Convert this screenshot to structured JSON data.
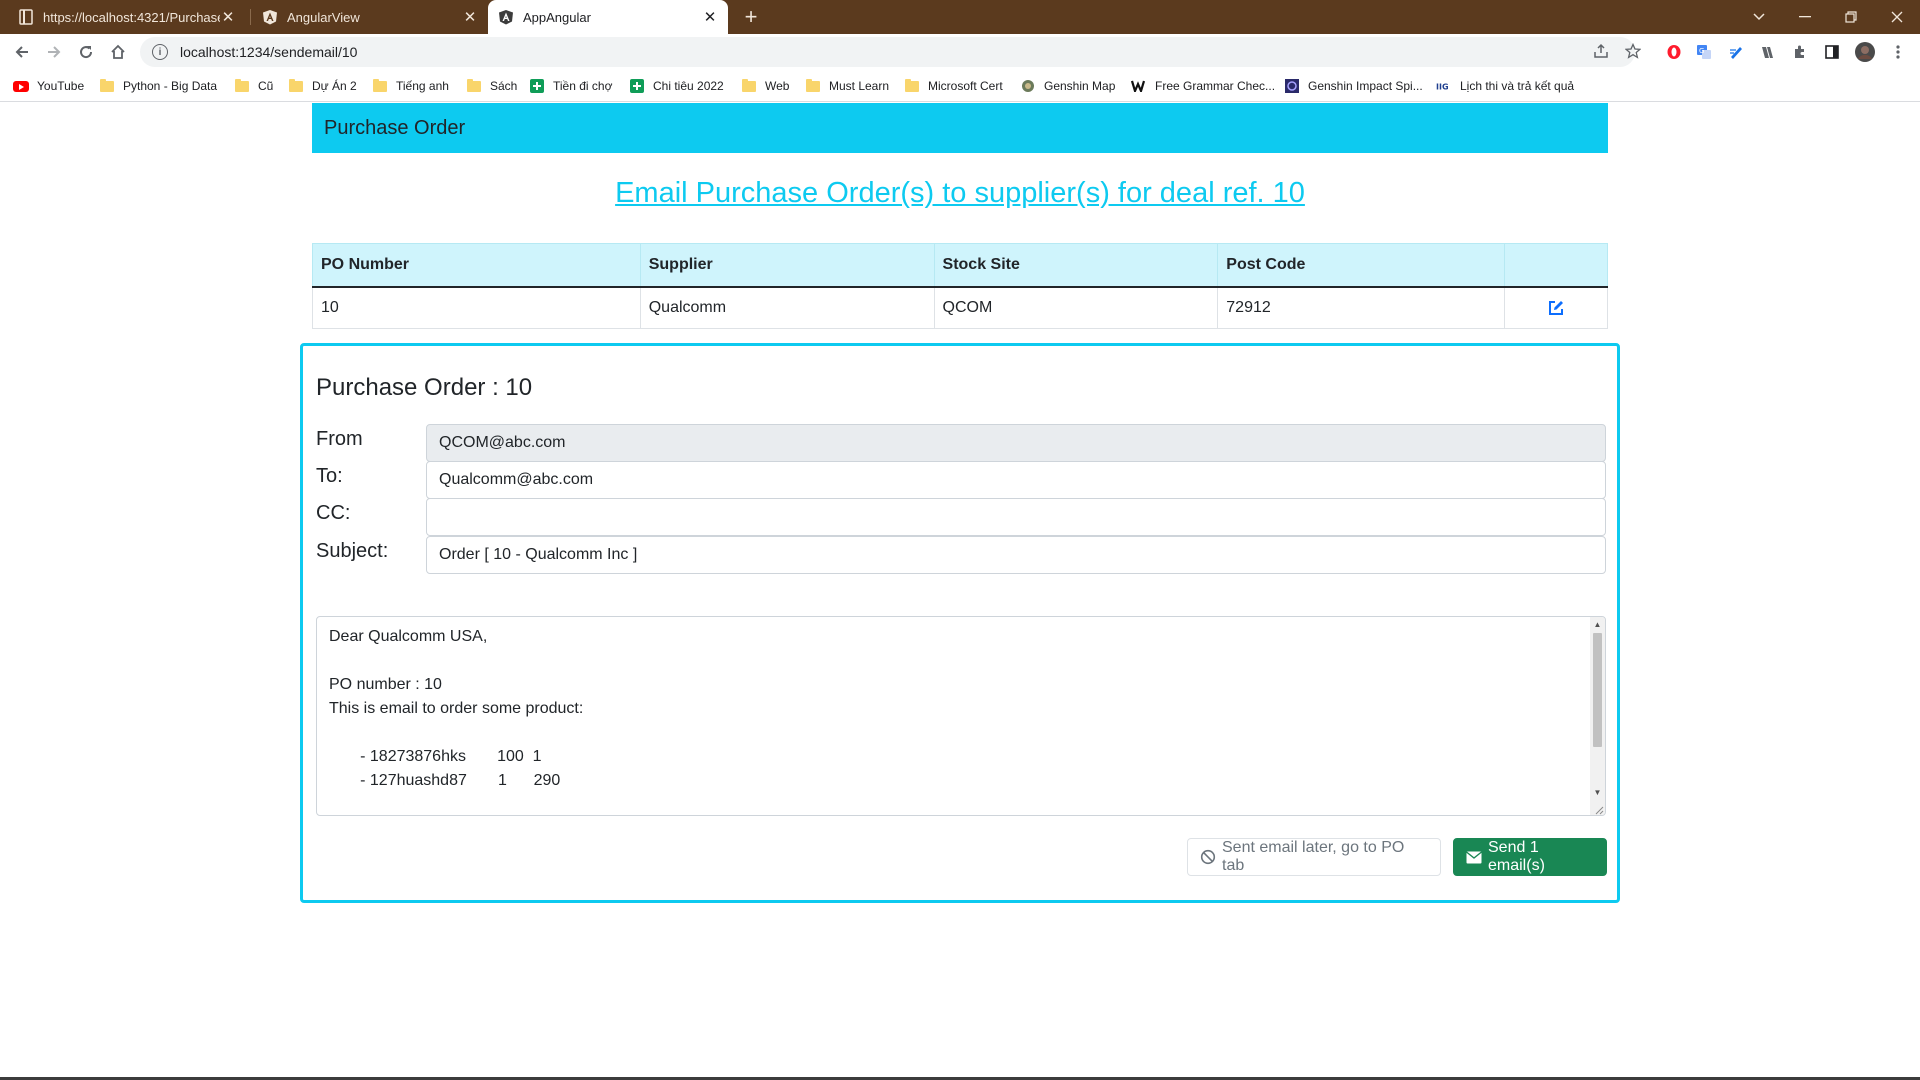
{
  "browser": {
    "tabs": [
      {
        "title": "https://localhost:4321/PurchaseC",
        "icon": "page-icon",
        "active": false
      },
      {
        "title": "AngularView",
        "icon": "angular-icon",
        "active": false
      },
      {
        "title": "AppAngular",
        "icon": "angular-icon",
        "active": true
      }
    ],
    "url": "localhost:1234/sendemail/10",
    "bookmarks": [
      {
        "label": "YouTube",
        "icon": "youtube-icon"
      },
      {
        "label": "Python - Big Data",
        "icon": "folder-icon"
      },
      {
        "label": "Cũ",
        "icon": "folder-icon"
      },
      {
        "label": "Dự Án 2",
        "icon": "folder-icon"
      },
      {
        "label": "Tiếng anh",
        "icon": "folder-icon"
      },
      {
        "label": "Sách",
        "icon": "folder-icon"
      },
      {
        "label": "Tiền đi chợ",
        "icon": "sheets-icon"
      },
      {
        "label": "Chi tiêu 2022",
        "icon": "sheets-icon"
      },
      {
        "label": "Web",
        "icon": "folder-icon"
      },
      {
        "label": "Must Learn",
        "icon": "folder-icon"
      },
      {
        "label": "Microsoft Cert",
        "icon": "folder-icon"
      },
      {
        "label": "Genshin Map",
        "icon": "genshin-icon"
      },
      {
        "label": "Free Grammar Chec...",
        "icon": "w-icon"
      },
      {
        "label": "Genshin Impact Spi...",
        "icon": "genshin-spiral-icon"
      },
      {
        "label": "Lịch thi và trả kết quả",
        "icon": "iig-icon"
      }
    ]
  },
  "app": {
    "brand": "Purchase Order",
    "heading": "Email Purchase Order(s) to supplier(s) for deal ref. 10",
    "table": {
      "headers": [
        "PO Number",
        "Supplier",
        "Stock Site",
        "Post Code",
        ""
      ],
      "rows": [
        {
          "po_number": "10",
          "supplier": "Qualcomm",
          "stock_site": "QCOM",
          "post_code": "72912"
        }
      ]
    },
    "email": {
      "title": "Purchase Order : 10",
      "from_label": "From",
      "from_value": "QCOM@abc.com",
      "to_label": "To:",
      "to_value": "Qualcomm@abc.com",
      "cc_label": "CC:",
      "cc_value": "",
      "subject_label": "Subject:",
      "subject_value": "Order [ 10 - Qualcomm Inc ]",
      "body": "Dear Qualcomm USA,\n\nPO number : 10\nThis is email to order some product:\n\n       - 18273876hks       100  1\n       - 127huashd87       1      290"
    },
    "buttons": {
      "later": "Sent email later, go to PO tab",
      "send": "Send 1 email(s)"
    }
  },
  "colors": {
    "accent": "#0dcaf0",
    "table_header": "#cff4fc",
    "send_button": "#198754",
    "tab_strip": "#5b3a1e"
  }
}
